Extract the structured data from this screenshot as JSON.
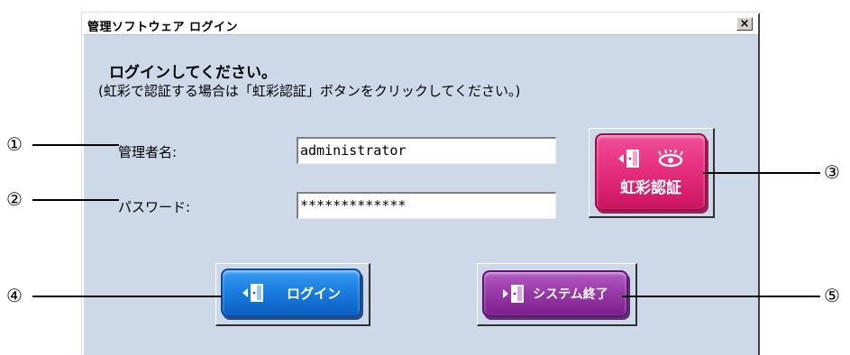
{
  "window": {
    "title": "管理ソフトウェア ログイン",
    "close_glyph": "×"
  },
  "instructions": {
    "line1": "ログインしてください。",
    "line2": "(虹彩で認証する場合は「虹彩認証」ボタンをクリックしてください。)"
  },
  "form": {
    "username_label": "管理者名:",
    "username_value": "administrator",
    "password_label": "パスワード:",
    "password_value": "*************"
  },
  "buttons": {
    "iris_label": "虹彩認証",
    "login_label": "ログイン",
    "exit_label": "システム終了"
  },
  "callouts": {
    "c1": "①",
    "c2": "②",
    "c3": "③",
    "c4": "④",
    "c5": "⑤"
  },
  "colors": {
    "dialog_bg": "#cdd9e8",
    "iris_button": "#e62f7e",
    "login_button": "#1a7fe0",
    "exit_button": "#9a3aaa"
  },
  "icons": {
    "door": "door-icon",
    "arrow": "arrow-left-icon",
    "eye": "eye-icon"
  }
}
